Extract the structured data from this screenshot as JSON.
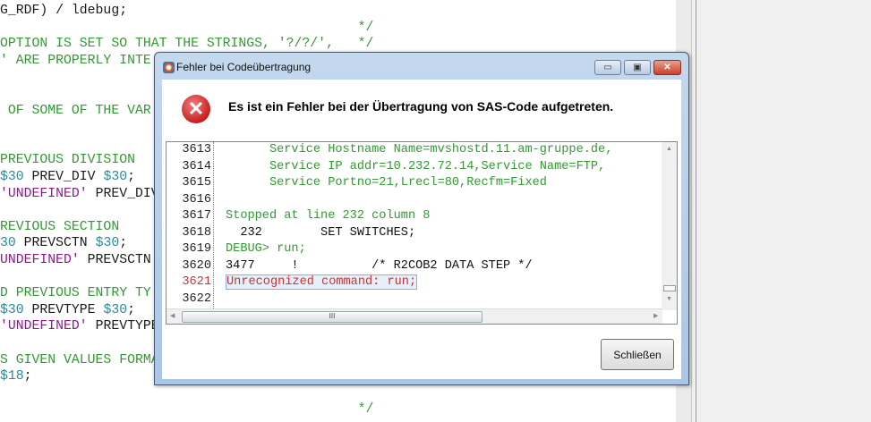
{
  "editor": {
    "lines": [
      {
        "parts": [
          {
            "t": "G_RDF) / ldebug;",
            "c": "k"
          }
        ]
      },
      {
        "parts": [
          {
            "t": "                                             */",
            "c": "c"
          }
        ]
      },
      {
        "parts": [
          {
            "t": "OPTION IS SET SO THAT THE STRINGS, '?/?/',   */",
            "c": "c"
          }
        ]
      },
      {
        "parts": [
          {
            "t": "' ARE PROPERLY INTE",
            "c": "c"
          }
        ]
      },
      {
        "parts": []
      },
      {
        "parts": []
      },
      {
        "parts": [
          {
            "t": " OF SOME OF THE VAR",
            "c": "c"
          }
        ]
      },
      {
        "parts": []
      },
      {
        "parts": []
      },
      {
        "parts": [
          {
            "t": "PREVIOUS DIVISION",
            "c": "c"
          }
        ]
      },
      {
        "parts": [
          {
            "t": "$30",
            "c": "n"
          },
          {
            "t": " PREV_DIV ",
            "c": "k"
          },
          {
            "t": "$30",
            "c": "n"
          },
          {
            "t": ";",
            "c": "k"
          }
        ]
      },
      {
        "parts": [
          {
            "t": "'UNDEFINED'",
            "c": "s"
          },
          {
            "t": " PREV_DIV",
            "c": "k"
          }
        ]
      },
      {
        "parts": []
      },
      {
        "parts": [
          {
            "t": "REVIOUS SECTION",
            "c": "c"
          }
        ]
      },
      {
        "parts": [
          {
            "t": "30",
            "c": "n"
          },
          {
            "t": " PREVSCTN ",
            "c": "k"
          },
          {
            "t": "$30",
            "c": "n"
          },
          {
            "t": ";",
            "c": "k"
          }
        ]
      },
      {
        "parts": [
          {
            "t": "UNDEFINED'",
            "c": "s"
          },
          {
            "t": " PREVSCTN",
            "c": "k"
          }
        ]
      },
      {
        "parts": []
      },
      {
        "parts": [
          {
            "t": "D PREVIOUS ENTRY TY",
            "c": "c"
          }
        ]
      },
      {
        "parts": [
          {
            "t": "$30",
            "c": "n"
          },
          {
            "t": " PREVTYPE ",
            "c": "k"
          },
          {
            "t": "$30",
            "c": "n"
          },
          {
            "t": ";",
            "c": "k"
          }
        ]
      },
      {
        "parts": [
          {
            "t": "'UNDEFINED'",
            "c": "s"
          },
          {
            "t": " PREVTYPE",
            "c": "k"
          }
        ]
      },
      {
        "parts": []
      },
      {
        "parts": [
          {
            "t": "S GIVEN VALUES FORMA",
            "c": "c"
          }
        ]
      },
      {
        "parts": [
          {
            "t": "$18",
            "c": "n"
          },
          {
            "t": ";",
            "c": "k"
          }
        ]
      },
      {
        "parts": []
      },
      {
        "parts": [
          {
            "t": "                                             */",
            "c": "c"
          }
        ]
      }
    ]
  },
  "dialog": {
    "title": "Fehler bei Codeübertragung",
    "minimize": "▭",
    "maximize": "▣",
    "close": "✕",
    "error_icon": "✕",
    "message": "Es ist ein Fehler bei der Übertragung von SAS-Code aufgetreten.",
    "log": [
      {
        "num": "3613",
        "text": "      Service Hostname Name=mvshostd.11.am-gruppe.de,",
        "c": "g"
      },
      {
        "num": "3614",
        "text": "      Service IP addr=10.232.72.14,Service Name=FTP,",
        "c": "g"
      },
      {
        "num": "3615",
        "text": "      Service Portno=21,Lrecl=80,Recfm=Fixed",
        "c": "g"
      },
      {
        "num": "3616",
        "text": "",
        "c": "g"
      },
      {
        "num": "3617",
        "text": "Stopped at line 232 column 8",
        "c": "g"
      },
      {
        "num": "3618",
        "text": "  232        SET SWITCHES;",
        "c": "b"
      },
      {
        "num": "3619",
        "text": "DEBUG> run;",
        "c": "g"
      },
      {
        "num": "3620",
        "text": "3477     !          /* R2COB2 DATA STEP */",
        "c": "b"
      },
      {
        "num": "3621",
        "text": "Unrecognized command: run;",
        "c": "r"
      },
      {
        "num": "3622",
        "text": "",
        "c": "b"
      }
    ],
    "hscroll_grip": "III",
    "close_button": "Schließen"
  }
}
